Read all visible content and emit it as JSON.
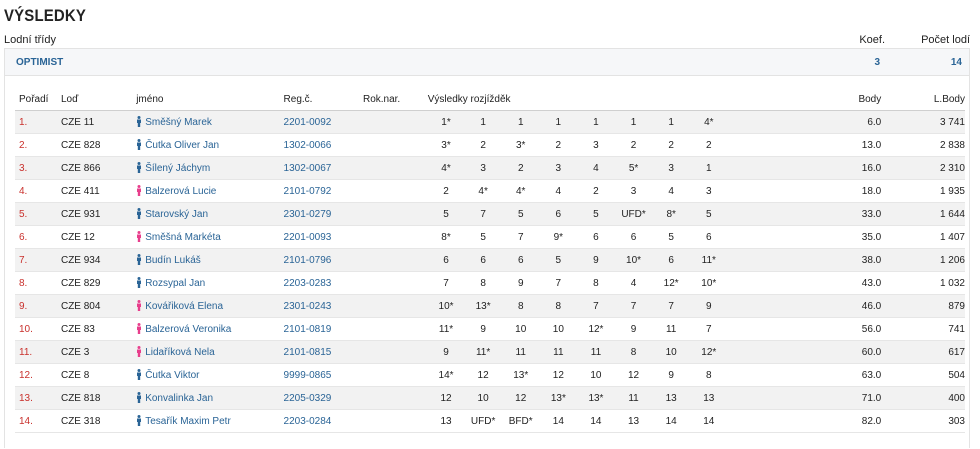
{
  "page": {
    "title": "VÝSLEDKY"
  },
  "header": {
    "classes_label": "Lodní třídy",
    "koef_label": "Koef.",
    "count_label": "Počet lodí"
  },
  "class": {
    "name": "OPTIMIST",
    "koef": "3",
    "count": "14"
  },
  "colors": {
    "accent": "#2a6496",
    "rank": "#c9302c",
    "male_icon": "#2a6496",
    "female_icon": "#e83e8c"
  },
  "columns": {
    "poradi": "Pořadí",
    "lod": "Loď",
    "jmeno": "jméno",
    "reg": "Reg.č.",
    "rok": "Rok.nar.",
    "races": "Výsledky rozjížděk",
    "body": "Body",
    "lbody": "L.Body"
  },
  "rows": [
    {
      "rank": "1.",
      "boat": "CZE 11",
      "gender": "m",
      "name": "Směšný Marek",
      "reg": "2201-0092",
      "races": [
        "1*",
        "1",
        "1",
        "1",
        "1",
        "1",
        "1",
        "4*"
      ],
      "body": "6.0",
      "lbody": "3 741"
    },
    {
      "rank": "2.",
      "boat": "CZE 828",
      "gender": "m",
      "name": "Čutka Oliver Jan",
      "reg": "1302-0066",
      "races": [
        "3*",
        "2",
        "3*",
        "2",
        "3",
        "2",
        "2",
        "2"
      ],
      "body": "13.0",
      "lbody": "2 838"
    },
    {
      "rank": "3.",
      "boat": "CZE 866",
      "gender": "m",
      "name": "Šílený Jáchym",
      "reg": "1302-0067",
      "races": [
        "4*",
        "3",
        "2",
        "3",
        "4",
        "5*",
        "3",
        "1"
      ],
      "body": "16.0",
      "lbody": "2 310"
    },
    {
      "rank": "4.",
      "boat": "CZE 411",
      "gender": "f",
      "name": "Balzerová Lucie",
      "reg": "2101-0792",
      "races": [
        "2",
        "4*",
        "4*",
        "4",
        "2",
        "3",
        "4",
        "3"
      ],
      "body": "18.0",
      "lbody": "1 935"
    },
    {
      "rank": "5.",
      "boat": "CZE 931",
      "gender": "m",
      "name": "Starovský Jan",
      "reg": "2301-0279",
      "races": [
        "5",
        "7",
        "5",
        "6",
        "5",
        "UFD*",
        "8*",
        "5"
      ],
      "body": "33.0",
      "lbody": "1 644"
    },
    {
      "rank": "6.",
      "boat": "CZE 12",
      "gender": "f",
      "name": "Směšná Markéta",
      "reg": "2201-0093",
      "races": [
        "8*",
        "5",
        "7",
        "9*",
        "6",
        "6",
        "5",
        "6"
      ],
      "body": "35.0",
      "lbody": "1 407"
    },
    {
      "rank": "7.",
      "boat": "CZE 934",
      "gender": "m",
      "name": "Budín Lukáš",
      "reg": "2101-0796",
      "races": [
        "6",
        "6",
        "6",
        "5",
        "9",
        "10*",
        "6",
        "11*"
      ],
      "body": "38.0",
      "lbody": "1 206"
    },
    {
      "rank": "8.",
      "boat": "CZE 829",
      "gender": "m",
      "name": "Rozsypal Jan",
      "reg": "2203-0283",
      "races": [
        "7",
        "8",
        "9",
        "7",
        "8",
        "4",
        "12*",
        "10*"
      ],
      "body": "43.0",
      "lbody": "1 032"
    },
    {
      "rank": "9.",
      "boat": "CZE 804",
      "gender": "f",
      "name": "Kovářiková Elena",
      "reg": "2301-0243",
      "races": [
        "10*",
        "13*",
        "8",
        "8",
        "7",
        "7",
        "7",
        "9"
      ],
      "body": "46.0",
      "lbody": "879"
    },
    {
      "rank": "10.",
      "boat": "CZE 83",
      "gender": "f",
      "name": "Balzerová Veronika",
      "reg": "2101-0819",
      "races": [
        "11*",
        "9",
        "10",
        "10",
        "12*",
        "9",
        "11",
        "7"
      ],
      "body": "56.0",
      "lbody": "741"
    },
    {
      "rank": "11.",
      "boat": "CZE 3",
      "gender": "f",
      "name": "Lidaříková Nela",
      "reg": "2101-0815",
      "races": [
        "9",
        "11*",
        "11",
        "11",
        "11",
        "8",
        "10",
        "12*"
      ],
      "body": "60.0",
      "lbody": "617"
    },
    {
      "rank": "12.",
      "boat": "CZE 8",
      "gender": "m",
      "name": "Čutka Viktor",
      "reg": "9999-0865",
      "races": [
        "14*",
        "12",
        "13*",
        "12",
        "10",
        "12",
        "9",
        "8"
      ],
      "body": "63.0",
      "lbody": "504"
    },
    {
      "rank": "13.",
      "boat": "CZE 818",
      "gender": "m",
      "name": "Konvalinka Jan",
      "reg": "2205-0329",
      "races": [
        "12",
        "10",
        "12",
        "13*",
        "13*",
        "11",
        "13",
        "13"
      ],
      "body": "71.0",
      "lbody": "400"
    },
    {
      "rank": "14.",
      "boat": "CZE 318",
      "gender": "m",
      "name": "Tesařík Maxim Petr",
      "reg": "2203-0284",
      "races": [
        "13",
        "UFD*",
        "BFD*",
        "14",
        "14",
        "13",
        "14",
        "14"
      ],
      "body": "82.0",
      "lbody": "303"
    }
  ]
}
